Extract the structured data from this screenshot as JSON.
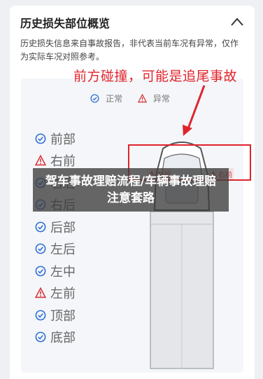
{
  "section": {
    "title": "历史损失部位概览",
    "description": "历史损失信息来自事故报告，非代表当前车况有异常，仅作为实际车况对照参考。"
  },
  "legend": {
    "normal_label": "正常",
    "abnormal_label": "异常"
  },
  "parts": [
    {
      "label": "前部",
      "status": "normal"
    },
    {
      "label": "右前",
      "status": "abnormal"
    },
    {
      "label": "右后",
      "status": "normal"
    },
    {
      "label": "右后",
      "status": "normal"
    },
    {
      "label": "后部",
      "status": "normal"
    },
    {
      "label": "左后",
      "status": "normal"
    },
    {
      "label": "左中",
      "status": "normal"
    },
    {
      "label": "左前",
      "status": "abnormal"
    },
    {
      "label": "顶部",
      "status": "normal"
    },
    {
      "label": "底部",
      "status": "normal"
    }
  ],
  "damage_labels": {
    "left": "左前",
    "right": "右前"
  },
  "annotation": "前方碰撞，可能是追尾事故",
  "overlay_title": "驾车事故理赔流程/车辆事故理赔注意套路",
  "colors": {
    "normal": "#2f6fd6",
    "abnormal": "#d8373c",
    "annotation": "#e0242c"
  },
  "icons": {
    "collapse": "chevron-up-icon",
    "normal": "check-circle-icon",
    "abnormal": "warning-triangle-icon"
  }
}
